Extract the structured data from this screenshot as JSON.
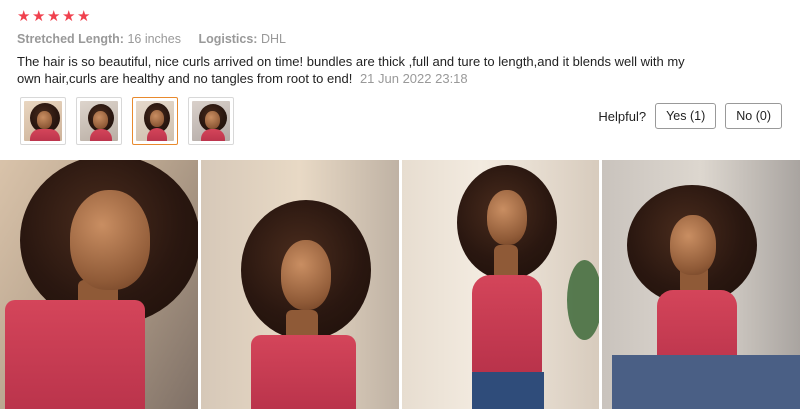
{
  "review": {
    "rating": 5,
    "stars": [
      "★",
      "★",
      "★",
      "★",
      "★"
    ],
    "star_color": "#f0414e",
    "attributes": [
      {
        "key": "Stretched Length:",
        "value": "16 inches"
      },
      {
        "key": "Logistics:",
        "value": "DHL"
      }
    ],
    "text": "The hair is so beautiful, nice curls arrived on time!  bundles are thick ,full and ture to length,and it blends well with my own hair,curls are healthy and no tangles from root to end!",
    "date": "21 Jun 2022 23:18",
    "thumbnails": [
      {
        "icon": "review-photo-thumbnail",
        "active": false
      },
      {
        "icon": "review-photo-thumbnail",
        "active": false
      },
      {
        "icon": "review-photo-thumbnail",
        "active": true
      },
      {
        "icon": "review-photo-thumbnail",
        "active": false
      }
    ],
    "thumbnail_active_color": "#e88a2e"
  },
  "helpful": {
    "question": "Helpful?",
    "yes_label": "Yes (1)",
    "no_label": "No (0)"
  },
  "gallery": {
    "photos": [
      {
        "icon": "review-photo"
      },
      {
        "icon": "review-photo"
      },
      {
        "icon": "review-photo"
      },
      {
        "icon": "review-photo"
      }
    ]
  }
}
